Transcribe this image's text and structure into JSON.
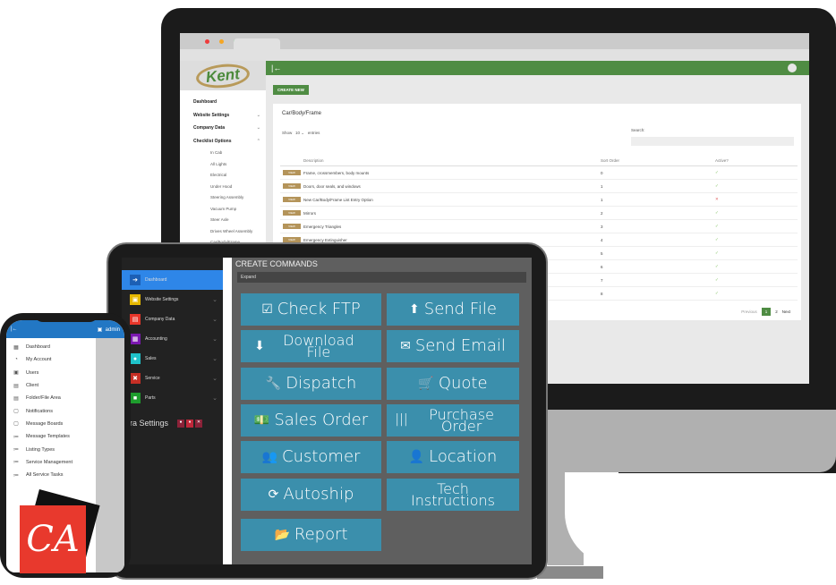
{
  "desktop": {
    "logo": "Kent",
    "header_back_icon": "|←",
    "create_new": "CREATE NEW",
    "sidebar": [
      {
        "label": "Dashboard",
        "chevron": ""
      },
      {
        "label": "Website Settings",
        "chevron": "⌄"
      },
      {
        "label": "Company Data",
        "chevron": "⌄"
      },
      {
        "label": "Checklist Options",
        "chevron": "⌃"
      }
    ],
    "subitems": [
      "In Cab",
      "All Lights",
      "Electrical",
      "Under Hood",
      "Steering Assembly",
      "Vacuum Pump",
      "Steer Axle",
      "Drives Wheel Assembly",
      "Car/Body/Frame"
    ],
    "card_title": "Car/Body/Frame",
    "show_label": "Show",
    "show_value": "10",
    "entries_label": "entries",
    "search_label": "Search:",
    "columns": [
      "",
      "Description",
      "Sort Order",
      "Active?"
    ],
    "view_label": "VIEW",
    "rows": [
      {
        "description": "Frame, crossmembers, body mounts",
        "sort": "0",
        "active": true
      },
      {
        "description": "Doors, door seals, and windows",
        "sort": "1",
        "active": true
      },
      {
        "description": "New Car/Body/Frame List Entry Option",
        "sort": "1",
        "active": false
      },
      {
        "description": "Mirrors",
        "sort": "2",
        "active": true
      },
      {
        "description": "Emergency Triangles",
        "sort": "3",
        "active": true
      },
      {
        "description": "Emergency Extinguisher",
        "sort": "4",
        "active": true
      },
      {
        "description": "",
        "sort": "5",
        "active": true
      },
      {
        "description": "",
        "sort": "6",
        "active": true
      },
      {
        "description": "",
        "sort": "7",
        "active": true
      },
      {
        "description": "",
        "sort": "8",
        "active": true
      }
    ],
    "pagination": {
      "previous": "Previous",
      "pages": [
        "1",
        "2"
      ],
      "current": "1",
      "next": "Next"
    },
    "check_glyph": "✓",
    "cross_glyph": "✕"
  },
  "tablet": {
    "sidebar": [
      {
        "label": "Dashboard",
        "icon": "➔",
        "color": "#1c5fb5",
        "active": true
      },
      {
        "label": "Website Settings",
        "icon": "▣",
        "color": "#e6b800"
      },
      {
        "label": "Company Data",
        "icon": "▤",
        "color": "#e8362a"
      },
      {
        "label": "Accounting",
        "icon": "▦",
        "color": "#7b18b0"
      },
      {
        "label": "Sales",
        "icon": "●",
        "color": "#1fc2c9"
      },
      {
        "label": "Service",
        "icon": "✖",
        "color": "#c62f25"
      },
      {
        "label": "Parts",
        "icon": "■",
        "color": "#1e9d2d"
      }
    ],
    "chevron": "⌄",
    "extra_settings": "Extra Settings",
    "header": "CREATE COMMANDS",
    "expand": "Expand",
    "commands": [
      {
        "label": "Check FTP",
        "icon": "☑"
      },
      {
        "label": "Send File",
        "icon": "⬆"
      },
      {
        "label": "Download File",
        "icon": "⬇"
      },
      {
        "label": "Send Email",
        "icon": "✉"
      },
      {
        "label": "Dispatch",
        "icon": "🔧"
      },
      {
        "label": "Quote",
        "icon": "🛒"
      },
      {
        "label": "Sales Order",
        "icon": "💵"
      },
      {
        "label": "Purchase Order",
        "icon": "|||"
      },
      {
        "label": "Customer",
        "icon": "👥"
      },
      {
        "label": "Location",
        "icon": "👤"
      },
      {
        "label": "Autoship",
        "icon": "⟳"
      },
      {
        "label": "Tech Instructions",
        "icon": ""
      },
      {
        "label": "Report",
        "icon": "📂"
      }
    ]
  },
  "phone": {
    "back": "|←",
    "user": "admin",
    "menu": [
      {
        "label": "Dashboard",
        "icon": "▦"
      },
      {
        "label": "My Account",
        "icon": "◔"
      },
      {
        "label": "Users",
        "icon": "▣"
      },
      {
        "label": "Client",
        "icon": "▤"
      },
      {
        "label": "Folder/File Area",
        "icon": "▤"
      },
      {
        "label": "Notifications",
        "icon": "▢"
      },
      {
        "label": "Message Boards",
        "icon": "▢"
      },
      {
        "label": "Message Templates",
        "icon": "≔"
      },
      {
        "label": "Listing Types",
        "icon": "≔"
      },
      {
        "label": "Service Management",
        "icon": "≔"
      },
      {
        "label": "All Service Tasks",
        "icon": "≔"
      }
    ],
    "brand_logo": "CA"
  }
}
